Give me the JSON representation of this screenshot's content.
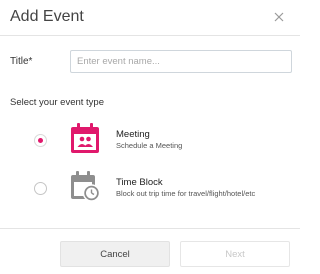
{
  "dialog": {
    "title": "Add Event",
    "close_icon": "close-icon"
  },
  "form": {
    "title_label": "Title*",
    "title_value": "",
    "title_placeholder": "Enter event name...",
    "type_section_label": "Select your event type"
  },
  "event_types": [
    {
      "name": "Meeting",
      "description": "Schedule a Meeting",
      "icon": "calendar-people-icon",
      "selected": true,
      "color": "#e0186c"
    },
    {
      "name": "Time Block",
      "description": "Block out trip time for travel/flight/hotel/etc",
      "icon": "calendar-clock-icon",
      "selected": false,
      "color": "#8e8e8e"
    }
  ],
  "footer": {
    "cancel_label": "Cancel",
    "next_label": "Next"
  },
  "colors": {
    "accent": "#e0186c",
    "disabled_text": "#c8c8c8"
  }
}
